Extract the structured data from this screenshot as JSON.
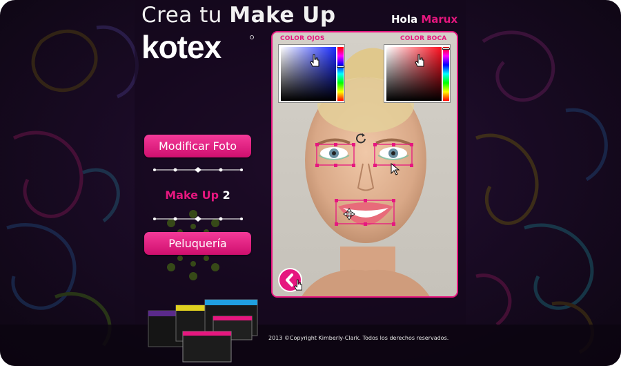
{
  "header": {
    "title_light": "Crea tu",
    "title_bold": "Make Up",
    "brand": "kotex",
    "greeting": "Hola",
    "user_name": "Marux"
  },
  "menu": {
    "modify_photo_label": "Modificar Foto",
    "makeup_label": "Make Up",
    "makeup_step": "2",
    "hair_label": "Peluquería"
  },
  "editor": {
    "eye_color_label": "COLOR OJOS",
    "mouth_color_label": "COLOR BOCA",
    "eye_color_hue": "#1a2cff",
    "mouth_color_hue": "#ff1020"
  },
  "footer": {
    "copyright": "2013 ©Copyright Kimberly-Clark. Todos los derechos reservados."
  },
  "colors": {
    "accent": "#e6177f",
    "background": "#1a0b25"
  }
}
